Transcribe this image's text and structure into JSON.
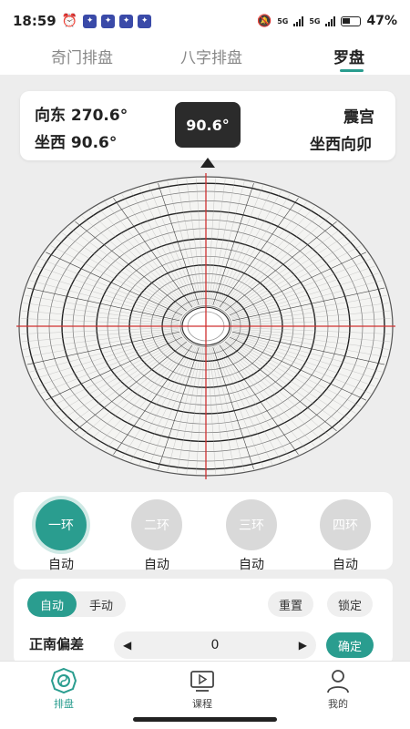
{
  "status": {
    "time": "18:59",
    "battery": "47%",
    "net1": "5G",
    "net2": "5G"
  },
  "tabs": [
    {
      "label": "奇门排盘"
    },
    {
      "label": "八字排盘"
    },
    {
      "label": "罗盘"
    }
  ],
  "direction": {
    "facing": "向东 270.6°",
    "sitting": "坐西 90.6°",
    "degree": "90.6°",
    "palace": "震宫",
    "orientation": "坐西向卯"
  },
  "rings": [
    {
      "label": "一环",
      "mode": "自动"
    },
    {
      "label": "二环",
      "mode": "自动"
    },
    {
      "label": "三环",
      "mode": "自动"
    },
    {
      "label": "四环",
      "mode": "自动"
    }
  ],
  "controls": {
    "auto": "自动",
    "manual": "手动",
    "reset": "重置",
    "lock": "锁定",
    "offset_label": "正南偏差",
    "offset_value": "0",
    "confirm": "确定"
  },
  "nav": [
    {
      "label": "排盘"
    },
    {
      "label": "课程"
    },
    {
      "label": "我的"
    }
  ],
  "colors": {
    "accent": "#2a9d8f",
    "badge": "#2b2b2b",
    "crosshair": "#d03030"
  }
}
